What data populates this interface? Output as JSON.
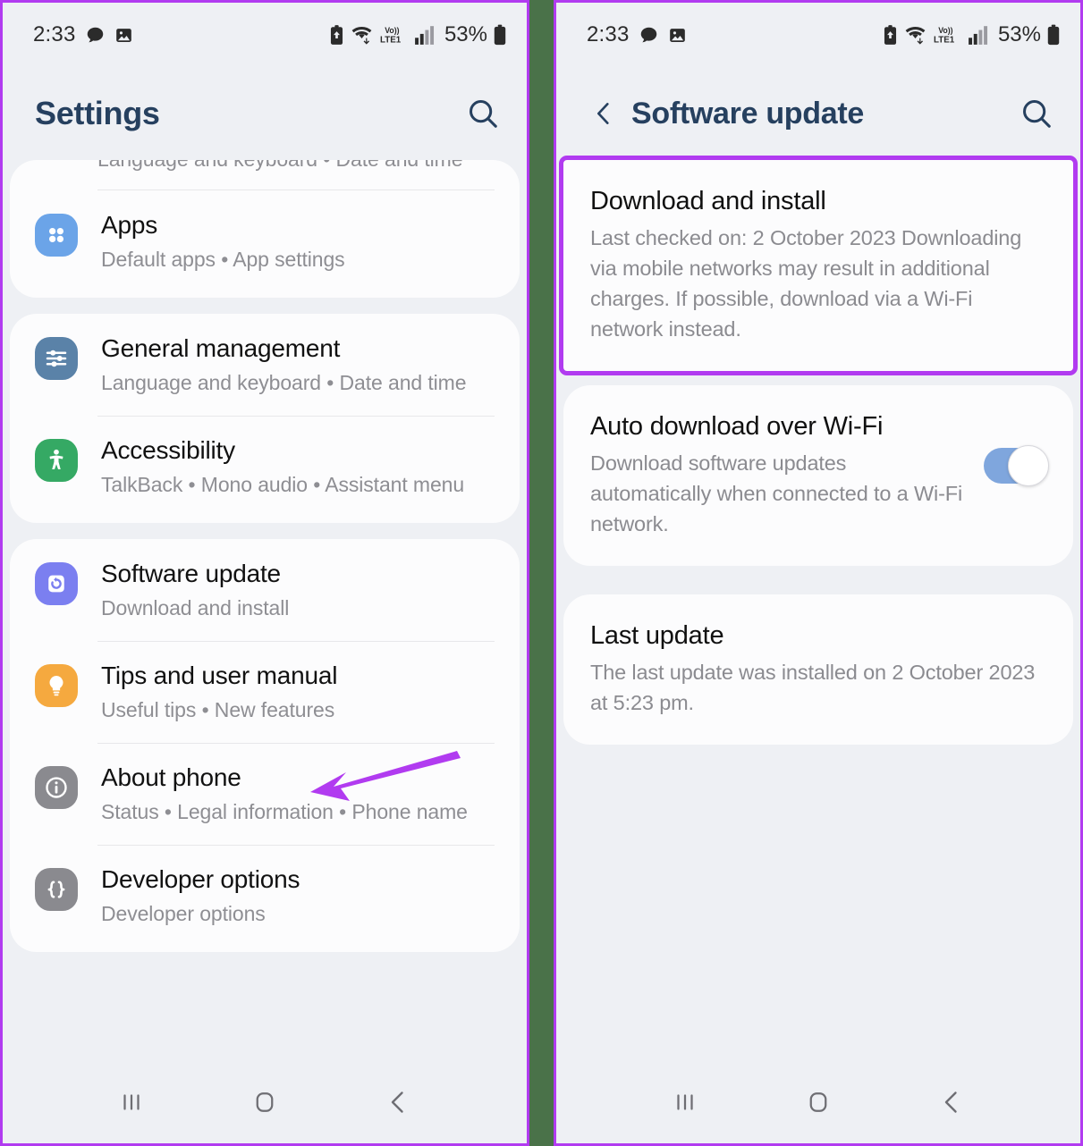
{
  "meta": {
    "accent_purple": "#b13bf0",
    "divider_green": "#4a7249",
    "panel_bg": "#eef0f4",
    "card_bg": "#fcfcfd",
    "title_color": "#26405f"
  },
  "status_bar": {
    "time": "2:33",
    "left_icons": [
      "message-bubble-icon",
      "image-icon"
    ],
    "right_icons": [
      "alarm-battery-icon",
      "wifi-data-icon",
      "volte1-icon",
      "signal-bars-icon"
    ],
    "network_label": "VoLTE1",
    "battery_percent": "53%",
    "battery_icon": "battery-icon"
  },
  "left_panel": {
    "header": {
      "title": "Settings",
      "search_icon": "search-icon"
    },
    "partial_row_above": {
      "subtitle": "Language and keyboard  •  Date and time"
    },
    "groups": [
      {
        "items": [
          {
            "title": "Apps",
            "subtitle": "Default apps  •  App settings",
            "icon": "apps-grid-icon",
            "icon_color": "#6ba4e8"
          }
        ]
      },
      {
        "items": [
          {
            "title": "General management",
            "subtitle": "Language and keyboard  •  Date and time",
            "icon": "sliders-icon",
            "icon_color": "#5a82a8"
          },
          {
            "title": "Accessibility",
            "subtitle": "TalkBack  •  Mono audio  •  Assistant menu",
            "icon": "accessibility-person-icon",
            "icon_color": "#35a964"
          }
        ]
      },
      {
        "items": [
          {
            "title": "Software update",
            "subtitle": "Download and install",
            "icon": "software-update-refresh-icon",
            "icon_color": "#7b7ff0"
          },
          {
            "title": "Tips and user manual",
            "subtitle": "Useful tips  •  New features",
            "icon": "lightbulb-icon",
            "icon_color": "#f5a councils"
          },
          {
            "title": "About phone",
            "subtitle": "Status  •  Legal information  •  Phone name",
            "icon": "info-circle-icon",
            "icon_color": "#8a8a8f"
          },
          {
            "title": "Developer options",
            "subtitle": "Developer options",
            "icon": "curly-braces-icon",
            "icon_color": "#8a8a8f"
          }
        ]
      }
    ],
    "annotation": {
      "type": "arrow",
      "color": "#b13bf0",
      "points_to": "Software update"
    }
  },
  "right_panel": {
    "header": {
      "back_icon": "back-chevron-icon",
      "title": "Software update",
      "search_icon": "search-icon"
    },
    "preferences": [
      {
        "title": "Download and install",
        "subtitle": "Last checked on: 2 October 2023\nDownloading via mobile networks may result in additional charges. If possible, download via a Wi-Fi network instead.",
        "highlighted": true,
        "has_toggle": false
      },
      {
        "title": "Auto download over Wi-Fi",
        "subtitle": "Download software updates automatically when connected to a Wi-Fi network.",
        "highlighted": false,
        "has_toggle": true,
        "toggle_on": true
      },
      {
        "title": "Last update",
        "subtitle": "The last update was installed on 2 October 2023 at 5:23 pm.",
        "highlighted": false,
        "has_toggle": false
      }
    ]
  },
  "nav_bar": {
    "recents_label": "recents-icon",
    "home_label": "home-icon",
    "back_label": "back-icon"
  }
}
